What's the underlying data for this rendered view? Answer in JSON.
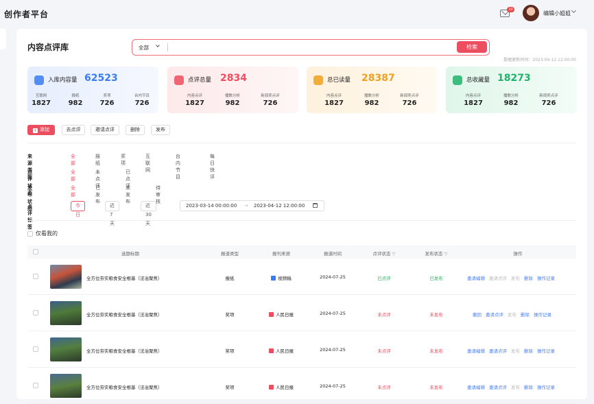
{
  "app": {
    "logo": "创作者平台"
  },
  "header": {
    "notification_count": "10",
    "user_name": "编辑小姐姐"
  },
  "page": {
    "title": "内容点评库",
    "updated": "数据更新时间：2023-04-12 12:00:00"
  },
  "search": {
    "scope": "全部",
    "placeholder": "",
    "button": "检索"
  },
  "stats": [
    {
      "label": "入库内容量",
      "total": "62523",
      "color": "#3a7cf0",
      "subs": [
        {
          "k": "互联网",
          "v": "1827"
        },
        {
          "k": "报纸",
          "v": "982"
        },
        {
          "k": "奖项",
          "v": "726"
        },
        {
          "k": "台内节目",
          "v": "726"
        }
      ]
    },
    {
      "label": "点评总量",
      "total": "2834",
      "color": "#ec4d5f",
      "subs": [
        {
          "k": "内容点评",
          "v": "1827"
        },
        {
          "k": "播数分析",
          "v": "982"
        },
        {
          "k": "新闻奖点评",
          "v": "726"
        }
      ]
    },
    {
      "label": "总已读量",
      "total": "28387",
      "color": "#f0a020",
      "subs": [
        {
          "k": "内容点评",
          "v": "1827"
        },
        {
          "k": "播数分析",
          "v": "982"
        },
        {
          "k": "新闻奖点评",
          "v": "726"
        }
      ]
    },
    {
      "label": "总收藏量",
      "total": "18273",
      "color": "#1fb36b",
      "subs": [
        {
          "k": "内容点评",
          "v": "1827"
        },
        {
          "k": "播数分析",
          "v": "982"
        },
        {
          "k": "新闻奖点评",
          "v": "726"
        }
      ]
    }
  ],
  "toolbar": {
    "add": "添加",
    "go_review": "去点评",
    "invite": "邀请点评",
    "delete": "删除",
    "publish": "发布"
  },
  "filters": {
    "source": {
      "label": "来源类型",
      "options": [
        "全部",
        "报纸",
        "奖项",
        "互联网",
        "台内节目",
        "每日快评"
      ]
    },
    "review": {
      "label": "点评状态",
      "options": [
        "全部",
        "未点评",
        "已点评"
      ]
    },
    "publish": {
      "label": "发布状态",
      "options": [
        "全部",
        "已发布",
        "未发布",
        "待审核"
      ]
    },
    "tags": {
      "label": "点评标签",
      "options": [
        "今日",
        "近7天",
        "近30天"
      ],
      "date_start": "2023-03-14 00:00:00",
      "date_sep": "→",
      "date_end": "2023-04-12 12:00:00"
    }
  },
  "only_mine": "仅看我的",
  "table": {
    "headers": [
      "选题标题",
      "报道类型",
      "报刊来源",
      "报道时间",
      "点评状态",
      "发布状态",
      "操作"
    ],
    "rows": [
      {
        "title": "全方位夯实粮食安全根基（法治聚焦）",
        "type": "报纸",
        "source": "视频稿",
        "source_color": "#3a7cf0",
        "date": "2024-07-25",
        "review": "已点评",
        "publish": "已发布",
        "ops": [
          [
            "邀请编辑",
            "b"
          ],
          [
            "邀请点评",
            "g"
          ],
          [
            "发布",
            "g"
          ],
          [
            "删除",
            "b"
          ],
          [
            "操作记录",
            "b"
          ]
        ]
      },
      {
        "title": "全方位夯实粮食安全根基（法治聚焦）",
        "type": "奖项",
        "source": "人民日报",
        "source_color": "#ec4d5f",
        "date": "2024-07-25",
        "review": "未点评",
        "publish": "未发布",
        "ops": [
          [
            "撤回",
            "b"
          ],
          [
            "邀请点评",
            "b"
          ],
          [
            "发布",
            "g"
          ],
          [
            "删除",
            "b"
          ],
          [
            "操作记录",
            "b"
          ]
        ]
      },
      {
        "title": "全方位夯实粮食安全根基（法治聚焦）",
        "type": "奖项",
        "source": "人民日报",
        "source_color": "#ec4d5f",
        "date": "2024-07-25",
        "review": "未点评",
        "publish": "未发布",
        "ops": [
          [
            "邀请编辑",
            "b"
          ],
          [
            "邀请点评",
            "b"
          ],
          [
            "发布",
            "g"
          ],
          [
            "删除",
            "b"
          ],
          [
            "操作记录",
            "b"
          ]
        ]
      },
      {
        "title": "全方位夯实粮食安全根基（法治聚焦）",
        "type": "奖项",
        "source": "人民日报",
        "source_color": "#ec4d5f",
        "date": "2024-07-25",
        "review": "未点评",
        "publish": "未发布",
        "ops": [
          [
            "邀请编辑",
            "b"
          ],
          [
            "邀请点评",
            "b"
          ],
          [
            "发布",
            "g"
          ],
          [
            "删除",
            "b"
          ],
          [
            "操作记录",
            "b"
          ]
        ]
      }
    ]
  }
}
